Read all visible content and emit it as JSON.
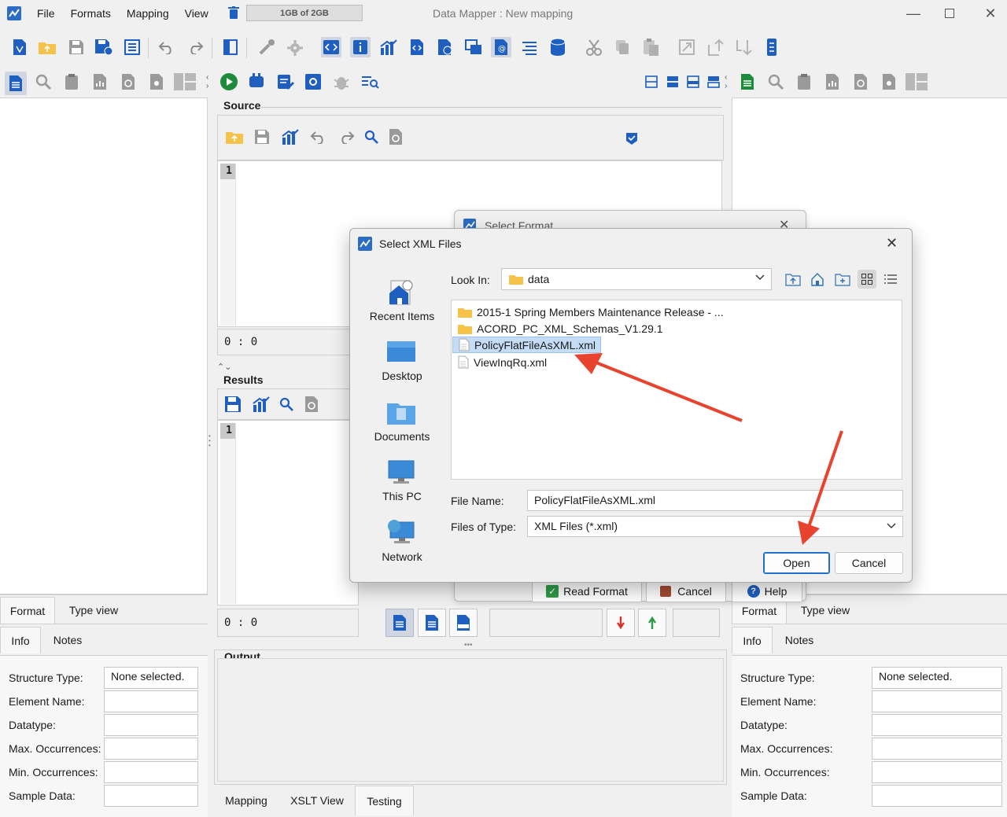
{
  "window": {
    "title": "Data Mapper : New mapping",
    "memory": "1GB of 2GB"
  },
  "menu": [
    "File",
    "Formats",
    "Mapping",
    "View"
  ],
  "source_panel": {
    "label": "Source",
    "line_number": "1",
    "cursor": "0 : 0"
  },
  "results_panel": {
    "label": "Results",
    "line_number": "1",
    "cursor": "0 : 0"
  },
  "output_panel": {
    "label": "Output"
  },
  "bottom_tabs": [
    "Mapping",
    "XSLT View",
    "Testing"
  ],
  "left_props": {
    "tabs": [
      "Format",
      "Type view"
    ],
    "subtabs": [
      "Info",
      "Notes"
    ],
    "fields": [
      {
        "label": "Structure Type:",
        "value": "None selected."
      },
      {
        "label": "Element Name:",
        "value": ""
      },
      {
        "label": "Datatype:",
        "value": ""
      },
      {
        "label": "Max. Occurrences:",
        "value": ""
      },
      {
        "label": "Min. Occurrences:",
        "value": ""
      },
      {
        "label": "Sample Data:",
        "value": ""
      }
    ]
  },
  "right_props": {
    "tabs": [
      "Format",
      "Type view"
    ],
    "subtabs": [
      "Info",
      "Notes"
    ],
    "fields": [
      {
        "label": "Structure Type:",
        "value": "None selected."
      },
      {
        "label": "Element Name:",
        "value": ""
      },
      {
        "label": "Datatype:",
        "value": ""
      },
      {
        "label": "Max. Occurrences:",
        "value": ""
      },
      {
        "label": "Min. Occurrences:",
        "value": ""
      },
      {
        "label": "Sample Data:",
        "value": ""
      }
    ]
  },
  "select_format_dialog": {
    "title": "Select Format",
    "buttons": {
      "read": "Read Format",
      "cancel": "Cancel",
      "help": "Help"
    }
  },
  "file_dialog": {
    "title": "Select XML Files",
    "look_in_label": "Look In:",
    "look_in_value": "data",
    "places": [
      "Recent Items",
      "Desktop",
      "Documents",
      "This PC",
      "Network"
    ],
    "files": [
      {
        "name": "2015-1 Spring Members Maintenance Release - ...",
        "type": "folder",
        "selected": false
      },
      {
        "name": "ACORD_PC_XML_Schemas_V1.29.1",
        "type": "folder",
        "selected": false
      },
      {
        "name": "PolicyFlatFileAsXML.xml",
        "type": "file",
        "selected": true
      },
      {
        "name": "ViewInqRq.xml",
        "type": "file",
        "selected": false
      }
    ],
    "file_name_label": "File Name:",
    "file_name_value": "PolicyFlatFileAsXML.xml",
    "file_type_label": "Files of Type:",
    "file_type_value": "XML Files (*.xml)",
    "open_label": "Open",
    "cancel_label": "Cancel"
  },
  "colors": {
    "accent": "#1f5fbf",
    "selection": "#c4dcf5",
    "arrow": "#e8432e",
    "folder": "#f5c24a"
  }
}
